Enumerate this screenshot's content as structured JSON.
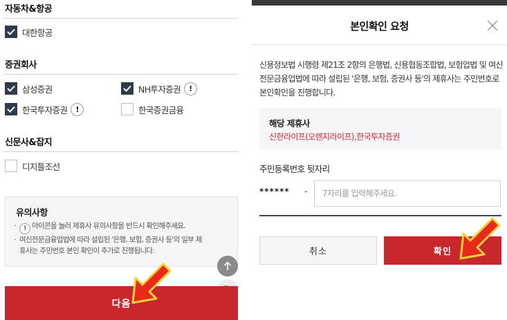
{
  "left_panel": {
    "categories": [
      {
        "title": "자동차&항공",
        "items": [
          {
            "label": "대한항공",
            "checked": true,
            "info": false
          }
        ]
      },
      {
        "title": "증권회사",
        "items": [
          {
            "label": "삼성증권",
            "checked": true,
            "info": false
          },
          {
            "label": "NH투자증권",
            "checked": true,
            "info": true
          },
          {
            "label": "한국투자증권",
            "checked": true,
            "info": true
          },
          {
            "label": "한국증권금융",
            "checked": false,
            "info": false
          }
        ]
      },
      {
        "title": "신문사&잡지",
        "items": [
          {
            "label": "디지틀조선",
            "checked": false,
            "info": false
          }
        ]
      }
    ],
    "info_glyph": "!",
    "notice": {
      "title": "유의사항",
      "line1": "아이콘을 눌러 제휴사 유의사항을 반드시 확인해주세요.",
      "line2a": "여신전문금융업법에 따라 설립된 '은행, 보험, 증권사 등'의 일부 제",
      "line2b": "휴사는 주민번호 본인 확인이 추가로 진행됩니다.",
      "bullet": "·"
    },
    "next_label": "다음"
  },
  "modal": {
    "title": "본인확인 요청",
    "description": "신용정보법 시행령 제21조 2항의 은행법, 신용협동조합법, 보험업법 및 여신전문금융업법에 따라 설립된 '은행, 보험, 증권사 등'의 제휴사는 주민번호로 본인확인을 진행합니다.",
    "partner_title": "해당 제휴사",
    "partner_value": "신한라이프(오렌지라이프),한국투자증권",
    "ssn_label": "주민등록번호 뒷자리",
    "ssn_mask": "******",
    "ssn_dash": "-",
    "ssn_placeholder": "7자리를 입력해주세요.",
    "cancel_label": "취소",
    "confirm_label": "확인"
  },
  "colors": {
    "accent_red": "#c8282c",
    "checkbox_navy": "#2f3a4c",
    "annotation_arrow": "#e8291c"
  },
  "icons": {
    "scroll_top": "arrow-up-icon",
    "share": "share-exit-icon",
    "close": "close-icon"
  }
}
